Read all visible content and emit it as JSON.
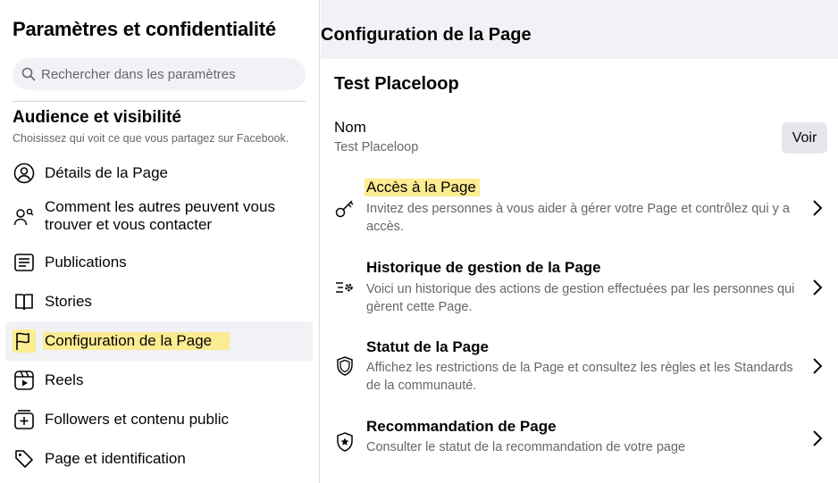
{
  "sidebar": {
    "title": "Paramètres et confidentialité",
    "search_placeholder": "Rechercher dans les paramètres",
    "section_title": "Audience et visibilité",
    "section_subtitle": "Choisissez qui voit ce que vous partagez sur Facebook.",
    "items": [
      {
        "label": "Détails de la Page",
        "icon": "user-circle-icon"
      },
      {
        "label": "Comment les autres peuvent vous trouver et vous contacter",
        "icon": "people-search-icon"
      },
      {
        "label": "Publications",
        "icon": "posts-icon"
      },
      {
        "label": "Stories",
        "icon": "book-icon"
      },
      {
        "label": "Configuration de la Page",
        "icon": "flag-icon",
        "active": true
      },
      {
        "label": "Reels",
        "icon": "reels-icon"
      },
      {
        "label": "Followers et contenu public",
        "icon": "plus-square-icon"
      },
      {
        "label": "Page et identification",
        "icon": "tag-icon"
      }
    ]
  },
  "main": {
    "title": "Configuration de la Page",
    "card_title": "Test Placeloop",
    "name_label": "Nom",
    "name_value": "Test Placeloop",
    "voir_label": "Voir",
    "rows": [
      {
        "title": "Accès à la Page",
        "desc": "Invitez des personnes à vous aider à gérer votre Page et contrôlez qui y a accès.",
        "icon": "key-icon"
      },
      {
        "title": "Historique de gestion de la Page",
        "desc": "Voici un historique des actions de gestion effectuées par les personnes qui gèrent cette Page.",
        "icon": "settings-list-icon"
      },
      {
        "title": "Statut de la Page",
        "desc": "Affichez les restrictions de la Page et consultez les règles et les Standards de la communauté.",
        "icon": "shield-icon"
      },
      {
        "title": "Recommandation de Page",
        "desc": "Consulter le statut de la recommandation de votre page",
        "icon": "shield-star-icon"
      }
    ]
  },
  "colors": {
    "highlight": "#fcec92",
    "background": "#f0f2f5",
    "secondary_text": "#65676b"
  }
}
